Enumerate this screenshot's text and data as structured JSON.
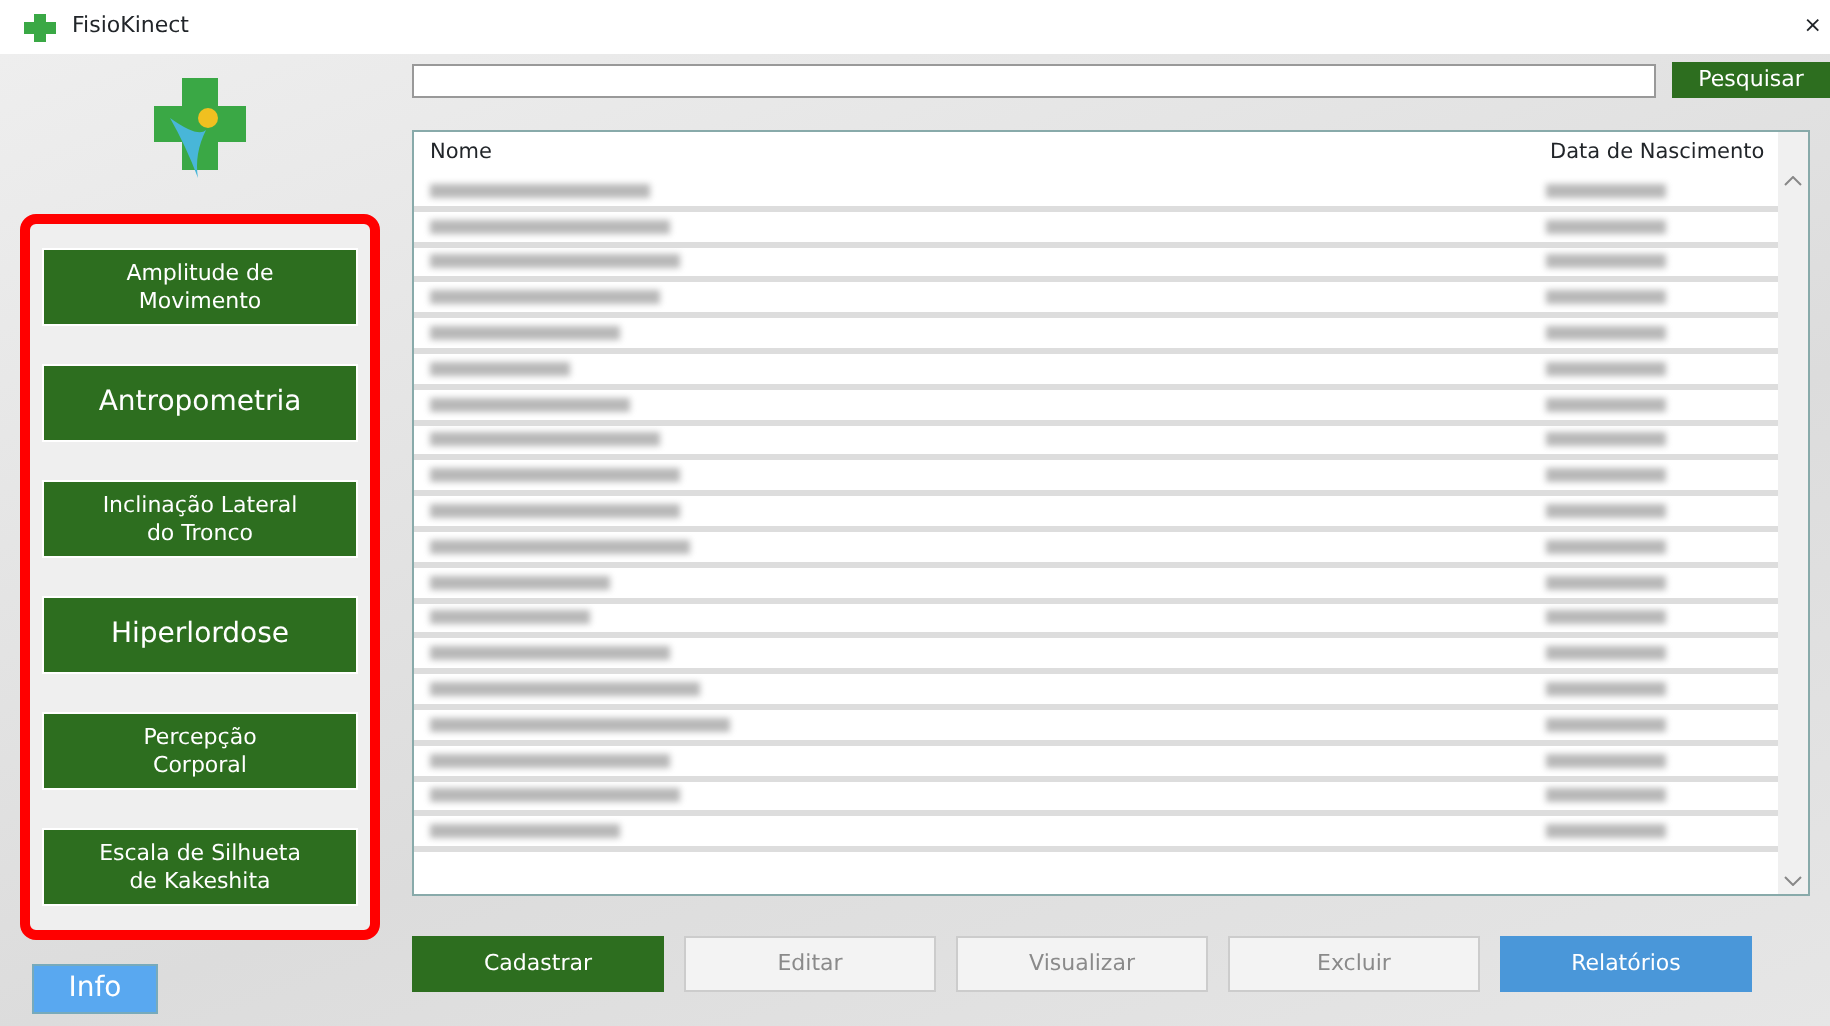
{
  "window": {
    "title": "FisioKinect",
    "close": "×"
  },
  "menu_panel": {
    "highlighted": true,
    "buttons": [
      {
        "label": "Amplitude de\nMovimento",
        "kind": "small"
      },
      {
        "label": "Antropometria",
        "kind": "large"
      },
      {
        "label": "Inclinação Lateral\ndo Tronco",
        "kind": "small"
      },
      {
        "label": "Hiperlordose",
        "kind": "large"
      },
      {
        "label": "Percepção\nCorporal",
        "kind": "small"
      },
      {
        "label": "Escala de Silhueta\nde Kakeshita",
        "kind": "small"
      }
    ]
  },
  "info_button": {
    "label": "Info"
  },
  "search": {
    "button": "Pesquisar"
  },
  "table": {
    "columns": [
      "Nome",
      "Data de Nascimento"
    ],
    "rows": [
      {
        "kind": "redacted"
      },
      {
        "kind": "redacted"
      },
      {
        "kind": "redacted"
      },
      {
        "kind": "redacted"
      },
      {
        "kind": "redacted"
      },
      {
        "kind": "redacted"
      },
      {
        "kind": "redacted"
      },
      {
        "kind": "redacted"
      },
      {
        "kind": "redacted"
      },
      {
        "kind": "redacted"
      },
      {
        "kind": "redacted"
      },
      {
        "kind": "redacted"
      },
      {
        "kind": "redacted"
      },
      {
        "kind": "redacted"
      },
      {
        "kind": "redacted"
      },
      {
        "kind": "redacted"
      },
      {
        "kind": "redacted"
      },
      {
        "kind": "redacted"
      },
      {
        "kind": "redacted"
      }
    ]
  },
  "actions": [
    {
      "label": "Cadastrar",
      "kind": "green",
      "disabled": false
    },
    {
      "label": "Editar",
      "kind": "plain",
      "disabled": true
    },
    {
      "label": "Visualizar",
      "kind": "plain",
      "disabled": true
    },
    {
      "label": "Excluir",
      "kind": "plain",
      "disabled": true
    },
    {
      "label": "Relatórios",
      "kind": "blue",
      "disabled": false
    }
  ]
}
